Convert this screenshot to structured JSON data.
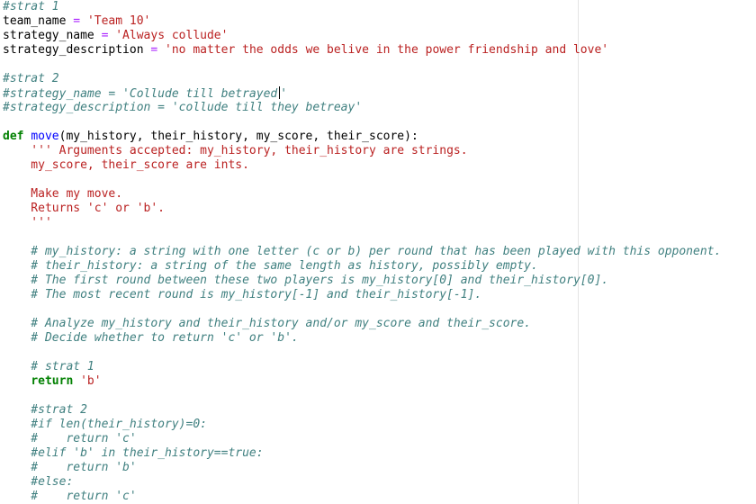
{
  "editor": {
    "l1": "#strat 1",
    "l2a": "team_name",
    "l2b": "'Team 10'",
    "l3a": "strategy_name",
    "l3b": "'Always collude'",
    "l4a": "strategy_description",
    "l4b": "'no matter the odds we belive in the power friendship and love'",
    "l6": "#strat 2",
    "l7a": "#strategy_name = 'Collude till betrayed",
    "l7b": "'",
    "l8": "#strategy_description = 'collude till they betreay'",
    "l10_kw": "def",
    "l10_fn": "move",
    "l10_rest": "(my_history, their_history, my_score, their_score):",
    "l11": "    ''' Arguments accepted: my_history, their_history are strings.",
    "l12": "    my_score, their_score are ints.",
    "l14": "    Make my move.",
    "l15": "    Returns 'c' or 'b'.",
    "l16": "    '''",
    "l18": "    # my_history: a string with one letter (c or b) per round that has been played with this opponent.",
    "l19": "    # their_history: a string of the same length as history, possibly empty.",
    "l20": "    # The first round between these two players is my_history[0] and their_history[0].",
    "l21": "    # The most recent round is my_history[-1] and their_history[-1].",
    "l23": "    # Analyze my_history and their_history and/or my_score and their_score.",
    "l24": "    # Decide whether to return 'c' or 'b'.",
    "l26": "    # strat 1",
    "l27_kw": "return",
    "l27_st": "'b'",
    "l29": "    #strat 2",
    "l30": "    #if len(their_history)=0:",
    "l31": "    #    return 'c'",
    "l32": "    #elif 'b' in their_history==true:",
    "l33": "    #    return 'b'",
    "l34": "    #else:",
    "l35": "    #    return 'c'"
  }
}
